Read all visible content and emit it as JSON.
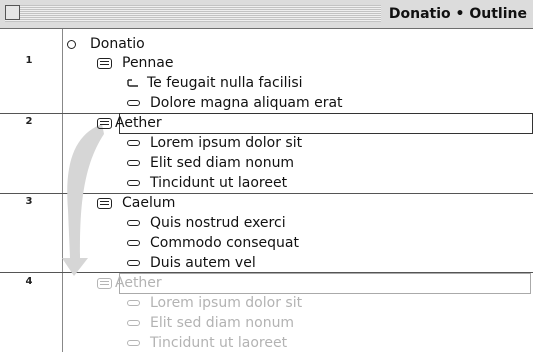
{
  "window": {
    "title": "Donatio • Outline"
  },
  "gutter_numbers": [
    "1",
    "2",
    "3",
    "4"
  ],
  "outline": {
    "root": "Donatio",
    "topics": [
      {
        "label": "Pennae",
        "items": [
          "Te feugait nulla facilisi",
          "Dolore magna aliquam erat"
        ]
      },
      {
        "label": "Aether",
        "items": [
          "Lorem ipsum dolor sit",
          "Elit sed diam nonum",
          "Tincidunt ut laoreet"
        ]
      },
      {
        "label": "Caelum",
        "items": [
          "Quis nostrud exerci",
          "Commodo consequat",
          "Duis autem vel"
        ]
      }
    ],
    "drag_ghost": {
      "label": "Aether",
      "items": [
        "Lorem ipsum dolor sit",
        "Elit sed diam nonum",
        "Tincidunt ut laoreet"
      ]
    }
  },
  "colors": {
    "drag_arrow": "#d6d6d6",
    "ghost_text": "#b3b3b3"
  }
}
